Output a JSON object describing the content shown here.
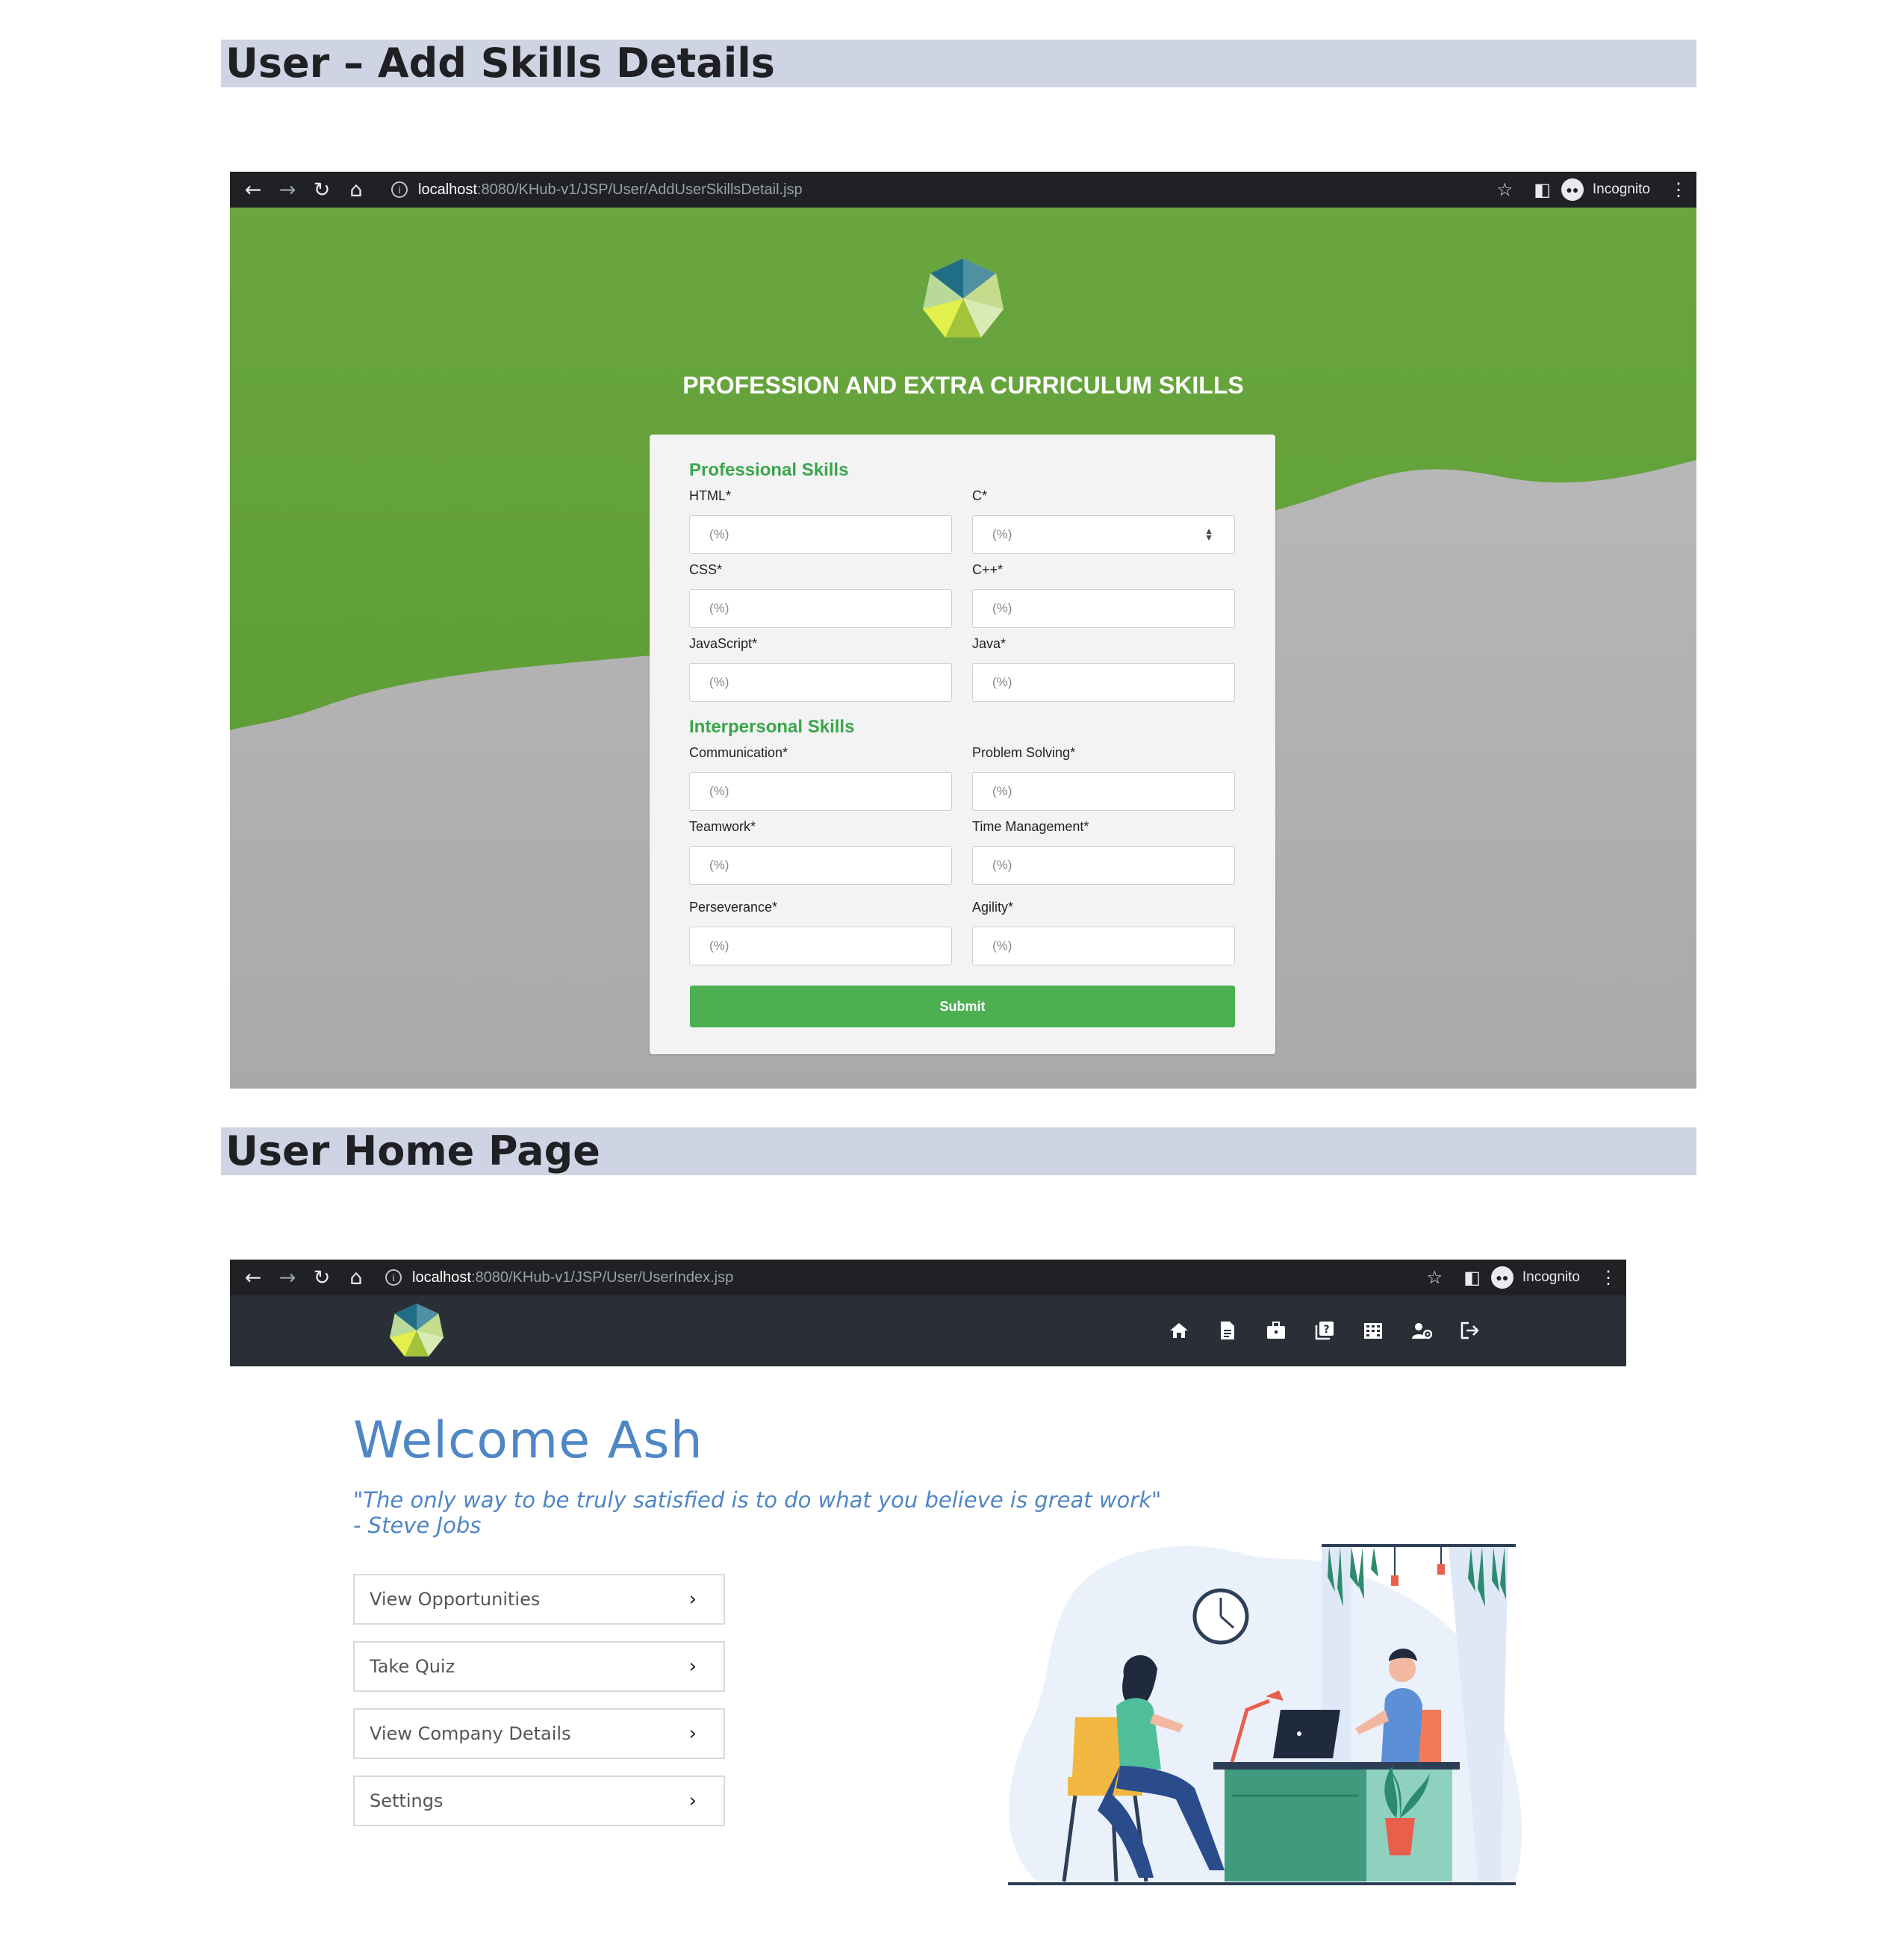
{
  "section1": {
    "title": "User – Add Skills Details"
  },
  "section2": {
    "title": "User Home Page"
  },
  "browser1": {
    "url_host": "localhost",
    "url_path": ":8080/KHub-v1/JSP/User/AddUserSkillsDetail.jsp",
    "incognito_label": "Incognito"
  },
  "browser2": {
    "url_host": "localhost",
    "url_path": ":8080/KHub-v1/JSP/User/UserIndex.jsp",
    "incognito_label": "Incognito"
  },
  "skills_page": {
    "heading": "PROFESSION AND EXTRA CURRICULUM SKILLS",
    "professional": {
      "title": "Professional Skills",
      "fields": [
        {
          "label": "HTML*",
          "placeholder": "(%)"
        },
        {
          "label": "C*",
          "placeholder": "(%)"
        },
        {
          "label": "CSS*",
          "placeholder": "(%)"
        },
        {
          "label": "C++*",
          "placeholder": "(%)"
        },
        {
          "label": "JavaScript*",
          "placeholder": "(%)"
        },
        {
          "label": "Java*",
          "placeholder": "(%)"
        }
      ]
    },
    "interpersonal": {
      "title": "Interpersonal Skills",
      "fields": [
        {
          "label": "Communication*",
          "placeholder": "(%)"
        },
        {
          "label": "Problem Solving*",
          "placeholder": "(%)"
        },
        {
          "label": "Teamwork*",
          "placeholder": "(%)"
        },
        {
          "label": "Time Management*",
          "placeholder": "(%)"
        },
        {
          "label": "Perseverance*",
          "placeholder": "(%)"
        },
        {
          "label": "Agility*",
          "placeholder": "(%)"
        }
      ]
    },
    "submit_label": "Submit",
    "colors": {
      "green_band": "#6aa63f",
      "accent": "#4caf50",
      "wave_grey": "#b3b3b3"
    }
  },
  "home_page": {
    "welcome": "Welcome Ash",
    "quote_line1": "\"The only way to be truly satisfied is to do what you believe is great work\"",
    "quote_line2": "- Steve Jobs",
    "menu": [
      {
        "label": "View Opportunities"
      },
      {
        "label": "Take Quiz"
      },
      {
        "label": "View Company Details"
      },
      {
        "label": "Settings"
      }
    ],
    "nav_icons": [
      "home-icon",
      "document-icon",
      "briefcase-icon",
      "quiz-icon",
      "company-icon",
      "user-settings-icon",
      "logout-icon"
    ],
    "colors": {
      "nav_bg": "#2a2f37",
      "text_blue": "#4f86c6"
    }
  }
}
